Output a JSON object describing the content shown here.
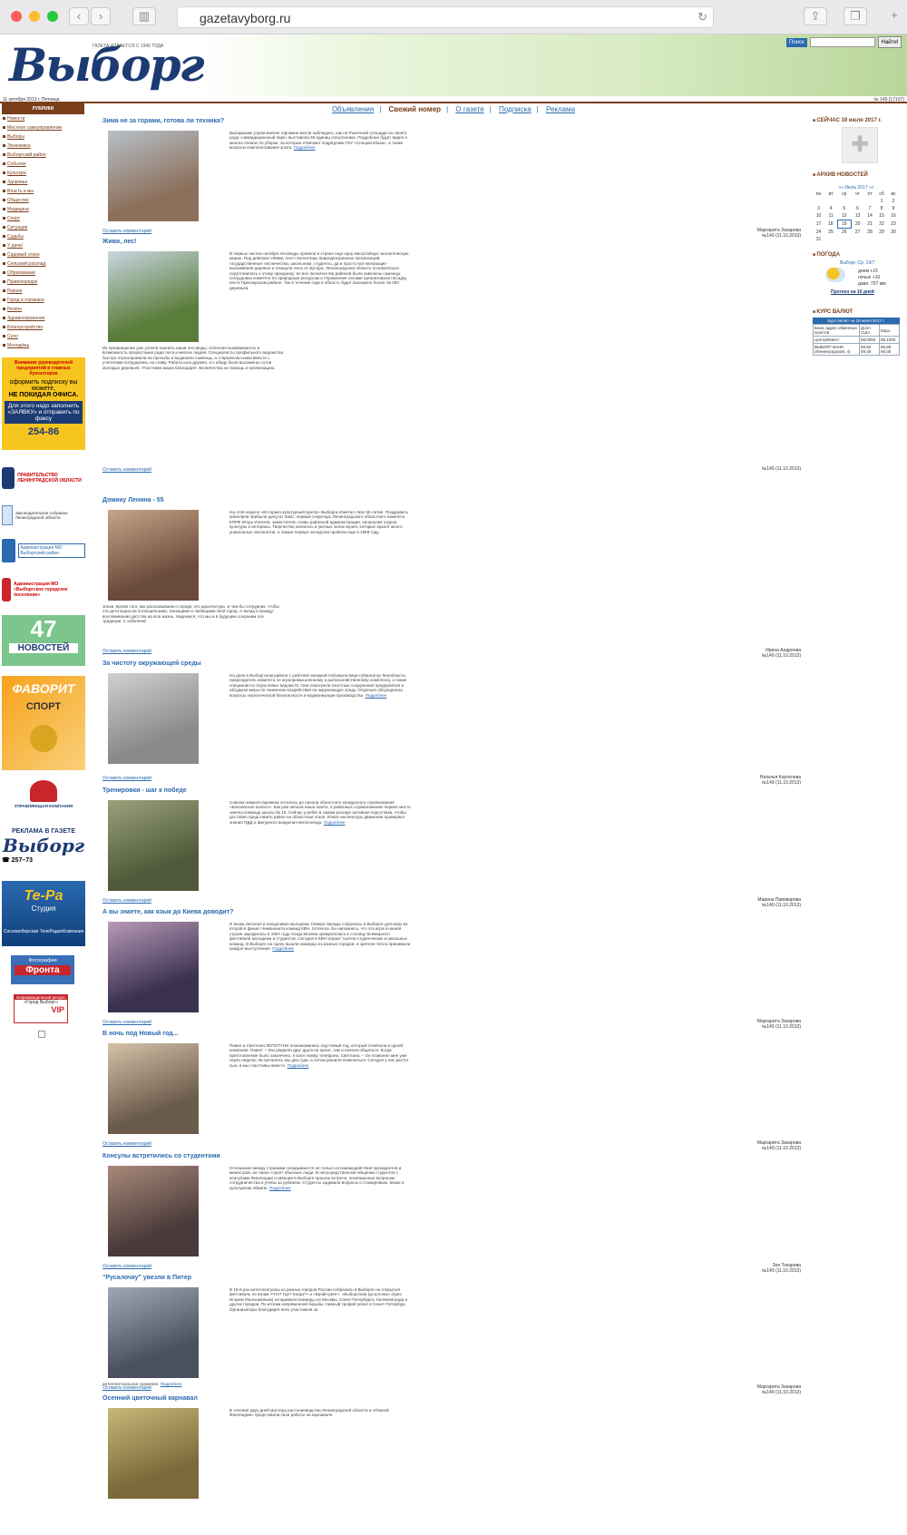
{
  "browser": {
    "url": "gazetavyborg.ru"
  },
  "header": {
    "logo": "Выборг",
    "since": "ГАЗЕТА ИЗДАЕТСЯ С 1940 ГОДА",
    "search_label": "Поиск",
    "search_button": "Найти!",
    "date": "11 октября 2013 г. Пятница",
    "issue": "№ 149 (17107)"
  },
  "topnav": [
    "Объявления",
    "Свежий номер",
    "О газете",
    "Подписка",
    "Реклама"
  ],
  "sidebar": {
    "title": "РУБРИКИ",
    "items": [
      "Новости",
      "Местное самоуправление",
      "Выборы",
      "Экономика",
      "Выборгский район",
      "События",
      "Культура",
      "Здоровье",
      "Власть и мы",
      "Общество",
      "Медицина",
      "Спорт",
      "Ситуация",
      "Судьбы",
      "У дачи!",
      "Садовый сезон",
      "Сельский расклад",
      "Образование",
      "Правопорядок",
      "Разное",
      "Город и горожане",
      "Регион",
      "Здравоохранение",
      "Благоустройство",
      "Село",
      "Молодёжь"
    ]
  },
  "ads": {
    "subscribe": [
      "Внимание руководителей предприятий и главных бухгалтеров",
      "оформить подписку вы можете,",
      "НЕ ПОКИДАЯ ОФИСА.",
      "Для этого надо заполнить «ЗАЯВКУ» и отправить по факсу",
      "254-86"
    ],
    "gov": "ПРАВИТЕЛЬСТВО ЛЕНИНГРАДСКОЙ ОБЛАСТИ",
    "zaks": "Законодательное собрание Ленинградской области",
    "admin": "Администрация МО Выборгский район",
    "mo": "Администрация МО «Выборгское городское поселение»",
    "news47": [
      "47",
      "НОВОСТЕЙ"
    ],
    "favorit": [
      "ФАВОРИТ",
      "СПОРТ"
    ],
    "uk": "УПРАВЛЯЮЩАЯ КОМПАНИЯ",
    "reklama": [
      "РЕКЛАМА В ГАЗЕТЕ",
      "Выборг",
      "☎ 257–73"
    ],
    "tera": [
      "Те-Ра",
      "Студия",
      "Сосновоборская ТелеРадиоКомпания"
    ],
    "foto": [
      "Фотография",
      "Фронта"
    ],
    "info": [
      "Информационный ресурс",
      "«Город Выборг»",
      "VIP"
    ]
  },
  "articles": [
    {
      "title": "Зима не за горами, готова ли техника?",
      "text": "Выездными утром многие горожане могли наблюдать, как на Рыночной площади на своего рода «ликвидационный парк» выставили 65 единиц спецтехники. Подробнее будет видно о многих планах по уборке, за которые отвечают подрядчики ГКУ «Спецавтобаза», а также вопросы комплектования штата.",
      "more": "Подробнее",
      "comment": "Оставить комментарий",
      "author": "Маргарита Захарова",
      "issue": "№149 (11.10.2013)"
    },
    {
      "title": "Живи, лес!",
      "text": "В первых числах октября лесоводы провели в стране еще одну масштабную экологическую акцию. Под девизом «Живи, лес!» волонтеры природоохранных организаций, государственные лесничества, школьники, студенты, да и просто все желающие высаживали деревья и очищали леса от мусора. Ленинградская область основательно подготовилась к этому празднику: во все лесничества районов были завезены саженцы. Сотрудники комитета по природным ресурсам и Управления лесами организовали посадку ели в Приозерском районе. Так в течение года в область будет высажено более 15 000 деревьев.",
      "text2": "Их превращение уже успели оценить наши лесоводы: отличная выживаемость и возможность прорастания ради леса и многих людей. Специалисты профильного ведомства быстро отреагировали на просьбы и выделили саженцы, а старшеклассники вместе с учителями потрудились на славу. Работа шла дружно, и к обеду были высажены сотни молодых деревьев. Участники акции благодарят лесничества за помощь и организацию.",
      "comment": "Оставить комментарий",
      "author": "",
      "issue": "№149 (11.10.2013)"
    },
    {
      "title": "Домику Ленина - 55",
      "text": "На этой неделе «Историко-культурный Центр» Выборга отметил свое 55-летие. Поздравить юбиляров прибыли депутат ЗакС, первый секретарь Ленинградского областного комитета КПРФ Игорь Изгачев, заместитель главы районной администрации, начальник отдела культуры и ветераны. Творчество началось в уютных залах музея, которые хранят много уникальных экспонатов, а самые первые экскурсии провели еще в 1958 году.",
      "text2": "эпохи. Кроме того, мы рассказываем о городе, его архитектуре, и чем бы сотрудник, чтобы эти дети выросли полноценными, знающими и любящими свой город. А вклад в правду: воспоминания детства на всю жизнь. Надеемся, что мы и в будущем сохраним эти традиции. С юбилеем!",
      "comment": "Оставить комментарий",
      "author": "Ирина Андреева",
      "issue": "№149 (11.10.2013)"
    },
    {
      "title": "За чистоту окружающей среды",
      "text": "На днях в Выборгском районе с рабочей поездкой побывали вице-губернатор Ленобласти, председатель комитета по агропромышленному и рыбохозяйственному комплексу, а также специалисты отраслевых ведомств. Они осмотрели очистные сооружения предприятия и обсудили меры по снижению воздействия на окружающую среду. Отдельно обсуждались вопросы экологической безопасности и модернизации производства.",
      "more": "Подробнее",
      "comment": "Оставить комментарий",
      "author": "Наталья Кортелева",
      "issue": "№149 (11.10.2013)"
    },
    {
      "title": "Тренировки - шаг к победе",
      "text": "Совсем немного времени осталось до начала областного конкурсного соревнования «Безопасное колесо». Как уже писала наша газета, в районных соревнованиях первое место заняла команда школы № 10. Сейчас у ребят в самом разгаре активная подготовка, чтобы достойно представить район на областном этапе. Юные инспекторы движения проверяют знания ПДД и фигурного вождения велосипеда.",
      "more": "Подробнее",
      "comment": "Оставить комментарий",
      "author": "Марина Пивоварова",
      "issue": "№149 (11.10.2013)"
    },
    {
      "title": "А вы знаете, как язык до Киева доводит?",
      "text": "И вновь веселая и находчивая молодежь Северо-Запада собралась в Выборге для игры во второй в финал Чемпионата команд КВН. Хотелось бы напомнить, что эта игра в нашей стране зародилась в 1957 году. Когда Москва превратилась в столицу Всемирного фестиваля молодежи и студентов. Сегодня в КВН играют тысячи студенческих и школьных команд. В Выборге на сцену вышли команды из разных городов, и зрители тепло принимали каждое выступление.",
      "more": "Подробнее",
      "comment": "Оставить комментарий",
      "author": "Маргарита Захарова",
      "issue": "№149 (11.10.2013)"
    },
    {
      "title": "В ночь под Новый год...",
      "text": "Павел и Светлана ЛЕПОТУНИ познакомились под Новый год, который отмечали в одной компании. Павел: – Мы увидели друг друга на кухне, там и начали общаться. Когда приготовление было закончено, я взял номер телефона. Светлана: – Он позвонил мне уже через неделю. Встречались мы два года, а потом решили пожениться. Сегодня у нас растет сын, и мы счастливы вместе.",
      "more": "Подробнее",
      "comment": "Оставить комментарий",
      "author": "Маргарита Захарова",
      "issue": "№149 (11.10.2013)"
    },
    {
      "title": "Консулы встретились со студентами",
      "text": "Отношения между странами складываются не только из взаимодействия президентов и министров, но также строят обычные люди. В непосредственном общении студентов с консулами Финляндии и Швеции в Выборге прошла встреча, посвященная вопросам сотрудничества и учебы за рубежом. Студенты задавали вопросы о стажировках, визах и культурном обмене.",
      "more": "Подробнее",
      "comment": "Оставить комментарий",
      "author": "Зоя Токарева",
      "issue": "№149 (11.10.2013)"
    },
    {
      "title": "\"Русалочку\" увезли в Питер",
      "text": "В 15-й раз интеллектуалы из разных городов России собрались в Выборге на открытый фестиваль по играм «Что? Где? Когда?» и «Брэйн-ринг». «Выборгская русалочка» (приз Игорем Малышкиным) оспаривали команды из Москвы, Санкт-Петербурга, Калининграда и других городов. По итогам напряженной борьбы главный трофей уехал в Санкт-Петербург. Организаторы благодарят всех участников за",
      "text2": "интеллектуальное сражение.",
      "more": "Подробнее",
      "comment": "Оставить комментарий",
      "author": "Маргарита Захарова",
      "issue": "№149 (11.10.2013)"
    },
    {
      "title": "Осенний цветочный карнавал",
      "text": "В течение двух дней мастера растениеводства Ленинградской области и «Южной Финляндии» представили свои работы на карнавале.",
      "comment": "",
      "author": "",
      "issue": ""
    }
  ],
  "right": {
    "now": "СЕЙЧАС 19 июля 2017 г.",
    "archive": "АРХИВ НОВОСТЕЙ",
    "cal_month": "Июль 2017",
    "cal_days": [
      "пн",
      "вт",
      "ср",
      "чт",
      "пт",
      "сб",
      "вс"
    ],
    "cal_rows": [
      [
        "",
        "",
        "",
        "",
        "",
        "1",
        "2"
      ],
      [
        "3",
        "4",
        "5",
        "6",
        "7",
        "8",
        "9"
      ],
      [
        "10",
        "11",
        "12",
        "13",
        "14",
        "15",
        "16"
      ],
      [
        "17",
        "18",
        "19",
        "20",
        "21",
        "22",
        "23"
      ],
      [
        "24",
        "25",
        "26",
        "27",
        "28",
        "29",
        "30"
      ],
      [
        "31",
        "",
        "",
        "",
        "",
        "",
        ""
      ]
    ],
    "weather": "ПОГОДА",
    "w_city": "Выборг, Ср, 19/7",
    "w_day": "днем +15",
    "w_night": "ночью +10",
    "w_press": "давл. 757 мм",
    "w_link": "Прогноз на 10 дней",
    "rates": "КУРС ВАЛЮТ",
    "rates_head": "Курс валют на 19 июля 2017 г.",
    "rate_cols": [
      "Банк, адрес обменных пунктов",
      "Долл. США",
      "Евро"
    ],
    "rate_rows": [
      [
        "ЦентрИнвест",
        "59,0000",
        "68,1000"
      ],
      [
        "ВЫБОРГ-БАНК (Ленинградская, 4)",
        "58,50 59,35",
        "66,90 68,35"
      ]
    ]
  },
  "colors": {
    "accent": "#2a6ab0",
    "brown": "#7a3e1a",
    "brand": "#1d3b73"
  }
}
